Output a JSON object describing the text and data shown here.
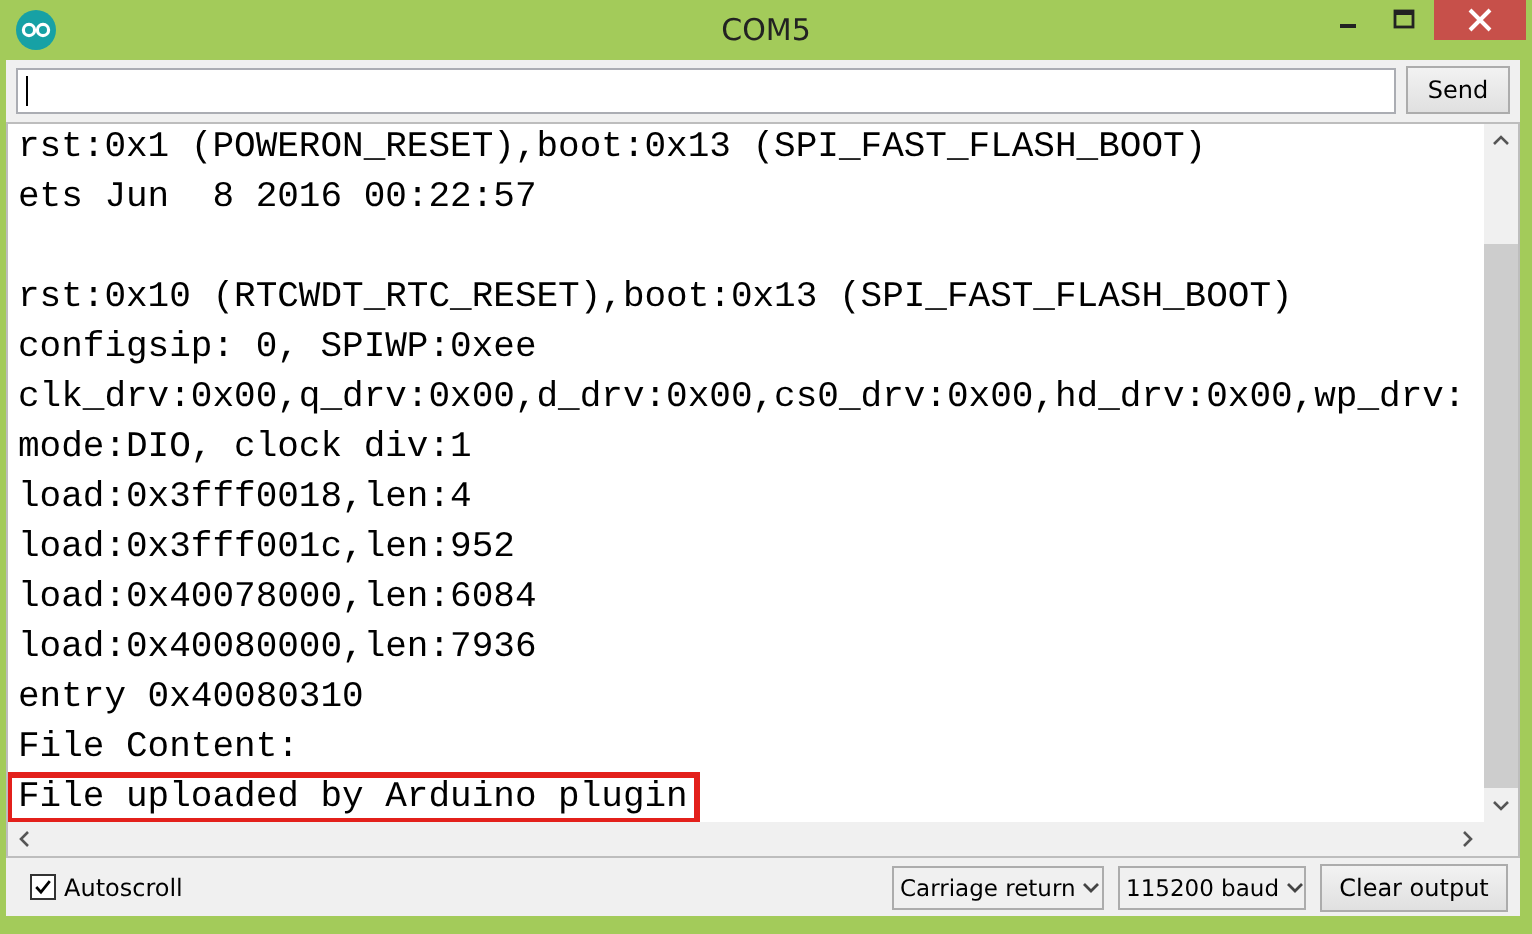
{
  "window": {
    "title": "COM5"
  },
  "input": {
    "focused": true
  },
  "send_button": "Send",
  "output_lines": [
    {
      "kind": "text",
      "text": "rst:0x1 (POWERON_RESET),boot:0x13 (SPI_FAST_FLASH_BOOT)",
      "highlighted": false
    },
    {
      "kind": "text",
      "text": "ets Jun  8 2016 00:22:57",
      "highlighted": false
    },
    {
      "kind": "blank"
    },
    {
      "kind": "text",
      "text": "rst:0x10 (RTCWDT_RTC_RESET),boot:0x13 (SPI_FAST_FLASH_BOOT)",
      "highlighted": false
    },
    {
      "kind": "text",
      "text": "configsip: 0, SPIWP:0xee",
      "highlighted": false
    },
    {
      "kind": "text",
      "text": "clk_drv:0x00,q_drv:0x00,d_drv:0x00,cs0_drv:0x00,hd_drv:0x00,wp_drv:",
      "highlighted": false
    },
    {
      "kind": "text",
      "text": "mode:DIO, clock div:1",
      "highlighted": false
    },
    {
      "kind": "text",
      "text": "load:0x3fff0018,len:4",
      "highlighted": false
    },
    {
      "kind": "text",
      "text": "load:0x3fff001c,len:952",
      "highlighted": false
    },
    {
      "kind": "text",
      "text": "load:0x40078000,len:6084",
      "highlighted": false
    },
    {
      "kind": "text",
      "text": "load:0x40080000,len:7936",
      "highlighted": false
    },
    {
      "kind": "text",
      "text": "entry 0x40080310",
      "highlighted": false
    },
    {
      "kind": "text",
      "text": "File Content:",
      "highlighted": false
    },
    {
      "kind": "text",
      "text": "File uploaded by Arduino plugin",
      "highlighted": true
    }
  ],
  "autoscroll": {
    "label": "Autoscroll",
    "checked": true
  },
  "line_ending": "Carriage return",
  "baud_rate": "115200 baud",
  "clear_button": "Clear output"
}
